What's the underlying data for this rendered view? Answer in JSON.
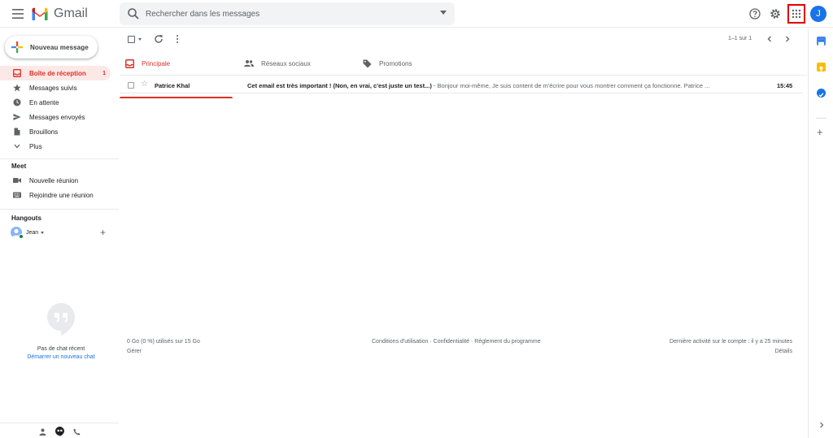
{
  "header": {
    "app_name": "Gmail",
    "search_placeholder": "Rechercher dans les messages",
    "avatar_initial": "J",
    "colors": {
      "apps_highlight": "#e00000",
      "avatar_bg": "#1a73e8"
    }
  },
  "sidebar": {
    "compose_label": "Nouveau message",
    "items": [
      {
        "label": "Boîte de réception",
        "icon": "inbox-icon",
        "count": "1",
        "active": true
      },
      {
        "label": "Messages suivis",
        "icon": "star-icon"
      },
      {
        "label": "En attente",
        "icon": "clock-icon"
      },
      {
        "label": "Messages envoyés",
        "icon": "send-icon"
      },
      {
        "label": "Brouillons",
        "icon": "draft-icon"
      },
      {
        "label": "Plus",
        "icon": "chevron-down-icon"
      }
    ],
    "meet": {
      "title": "Meet",
      "items": [
        {
          "label": "Nouvelle réunion",
          "icon": "video-icon"
        },
        {
          "label": "Rejoindre une réunion",
          "icon": "keyboard-icon"
        }
      ]
    },
    "hangouts": {
      "title": "Hangouts",
      "user_name": "Jean",
      "empty_text": "Pas de chat récent",
      "start_chat": "Démarrer un nouveau chat"
    }
  },
  "toolbar": {
    "pager_text": "1–1 sur 1"
  },
  "tabs": [
    {
      "label": "Principale",
      "icon": "inbox-icon",
      "active": true
    },
    {
      "label": "Réseaux sociaux",
      "icon": "people-icon"
    },
    {
      "label": "Promotions",
      "icon": "tag-icon"
    }
  ],
  "emails": [
    {
      "sender": "Patrice Khal",
      "subject": "Cet email est très important ! (Non, en vrai, c'est juste un test...)",
      "separator": " - ",
      "snippet": "Bonjour moi-même, Je suis content de m'écrire pour vous montrer comment ça fonctionne. Patrice ...",
      "time": "15:45"
    }
  ],
  "footer": {
    "storage": "0 Go (0 %) utilisés sur 15 Go",
    "manage": "Gérer",
    "links": [
      "Conditions d'utilisation",
      "Confidentialité",
      "Règlement du programme"
    ],
    "link_separator": " · ",
    "last_activity": "Dernière activité sur le compte : il y a 25 minutes",
    "details": "Détails"
  }
}
